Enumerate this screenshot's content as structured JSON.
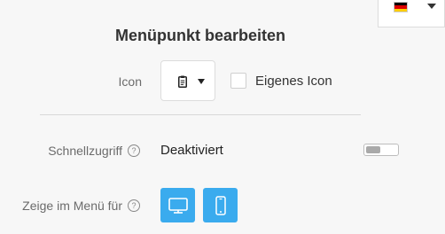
{
  "language": {
    "flag_colors": [
      "#000000",
      "#dd0000",
      "#ffce00"
    ],
    "icon": "chevron-down-icon"
  },
  "title": "Menüpunkt bearbeiten",
  "icon_row": {
    "label": "Icon",
    "selected_icon": "clipboard-icon",
    "custom_icon_label": "Eigenes Icon",
    "custom_icon_checked": false
  },
  "quick_access": {
    "label": "Schnellzugriff",
    "help_icon": "?",
    "status": "Deaktiviert",
    "enabled": false
  },
  "show_in_menu": {
    "label": "Zeige im Menü für",
    "help_icon": "?",
    "devices": [
      {
        "name": "desktop-icon",
        "active": true
      },
      {
        "name": "mobile-icon",
        "active": true
      }
    ],
    "accent": "#3aabee"
  }
}
